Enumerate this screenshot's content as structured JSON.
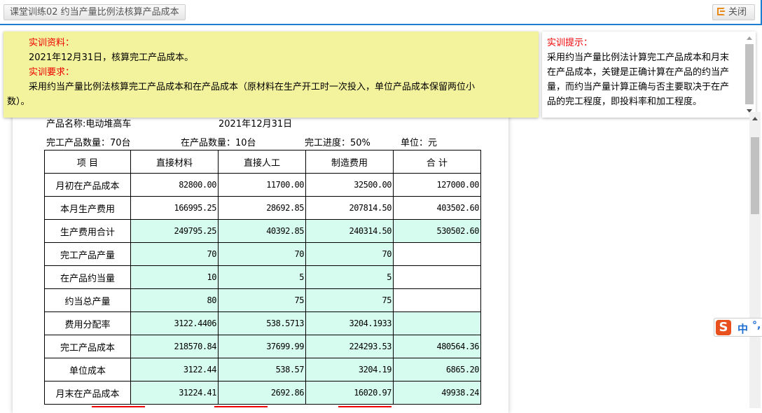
{
  "header": {
    "title": "课堂训练02 约当产量比例法核算产品成本",
    "close_label": "关闭"
  },
  "material": {
    "label1": "实训资料：",
    "text1": "2021年12月31日，核算完工产品成本。",
    "label2": "实训要求：",
    "text2a": "采用约当产量比例法核算完工产品成本和在产品成本（原材料在生产开工时一次投入，单位产品成本保留两位小",
    "text2b": "数）。"
  },
  "hint": {
    "label": "实训提示：",
    "text": "采用约当产量比例法计算完工产品成本和月末在产品成本，关键是正确计算在产品的约当产量，而约当产量计算正确与否主要取决于在产品的完工程度，即投料率和加工程度。"
  },
  "form": {
    "product": "产品名称:电动堆高车",
    "date": "2021年12月31日",
    "finished_qty": "完工产品数量：70台",
    "wip_qty": "在产品数量：10台",
    "progress": "完工进度：50%",
    "unit": "单位：元"
  },
  "table": {
    "headers": [
      "项 目",
      "直接材料",
      "直接人工",
      "制造费用",
      "合 计"
    ],
    "rows": [
      {
        "label": "月初在产品成本",
        "cells": [
          "82800.00",
          "11700.00",
          "32500.00",
          "127000.00"
        ],
        "green": [
          false,
          false,
          false,
          false
        ]
      },
      {
        "label": "本月生产费用",
        "cells": [
          "166995.25",
          "28692.85",
          "207814.50",
          "403502.60"
        ],
        "green": [
          false,
          false,
          false,
          false
        ]
      },
      {
        "label": "生产费用合计",
        "cells": [
          "249795.25",
          "40392.85",
          "240314.50",
          "530502.60"
        ],
        "green": [
          true,
          true,
          true,
          true
        ]
      },
      {
        "label": "完工产品产量",
        "cells": [
          "70",
          "70",
          "70",
          ""
        ],
        "green": [
          true,
          true,
          true,
          false
        ]
      },
      {
        "label": "在产品约当量",
        "cells": [
          "10",
          "5",
          "5",
          ""
        ],
        "green": [
          true,
          true,
          true,
          false
        ]
      },
      {
        "label": "约当总产量",
        "cells": [
          "80",
          "75",
          "75",
          ""
        ],
        "green": [
          true,
          true,
          true,
          false
        ]
      },
      {
        "label": "费用分配率",
        "cells": [
          "3122.4406",
          "538.5713",
          "3204.1933",
          ""
        ],
        "green": [
          true,
          true,
          true,
          true
        ]
      },
      {
        "label": "完工产品成本",
        "cells": [
          "218570.84",
          "37699.99",
          "224293.53",
          "480564.36"
        ],
        "green": [
          true,
          true,
          true,
          true
        ]
      },
      {
        "label": "单位成本",
        "cells": [
          "3122.44",
          "538.57",
          "3204.19",
          "6865.20"
        ],
        "green": [
          true,
          true,
          true,
          true
        ]
      },
      {
        "label": "月末在产品成本",
        "cells": [
          "31224.41",
          "2692.86",
          "16020.97",
          "49938.24"
        ],
        "green": [
          true,
          true,
          true,
          true
        ]
      }
    ]
  },
  "ime": {
    "logo": "S",
    "mode": "中",
    "punct": "°,"
  }
}
